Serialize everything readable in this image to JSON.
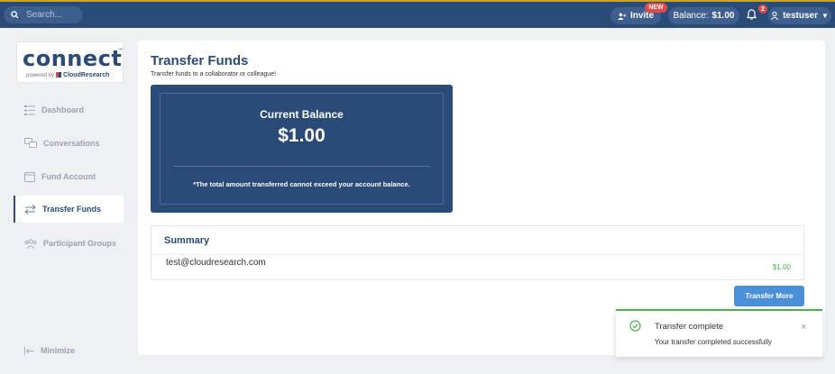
{
  "topbar": {
    "search_placeholder": "Search...",
    "invite_label": "Invite",
    "new_badge": "NEW",
    "balance_label": "Balance:",
    "balance_value": "$1.00",
    "notification_count": "2",
    "username": "testuser",
    "accent_color": "#2a4a78",
    "highlight_color": "#c9a52a"
  },
  "logo": {
    "name": "connect",
    "powered_by": "powered by",
    "brand": "CloudResearch",
    "trademark": "™"
  },
  "sidebar": {
    "items": [
      {
        "label": "Dashboard",
        "icon": "dashboard-icon"
      },
      {
        "label": "Conversations",
        "icon": "chat-icon"
      },
      {
        "label": "Fund Account",
        "icon": "wallet-icon"
      },
      {
        "label": "Transfer Funds",
        "icon": "transfer-icon",
        "active": true
      },
      {
        "label": "Participant Groups",
        "icon": "group-icon"
      }
    ],
    "minimize_label": "Minimize"
  },
  "main": {
    "title": "Transfer Funds",
    "subtitle": "Transfer funds to a collaborator or colleague!",
    "balance_card": {
      "label": "Current Balance",
      "value": "$1.00",
      "note": "*The total amount transferred cannot exceed your account balance."
    },
    "summary": {
      "title": "Summary",
      "email": "test@cloudresearch.com",
      "amount": "$1.00"
    },
    "transfer_more_label": "Transfer More"
  },
  "toast": {
    "title": "Transfer complete",
    "message": "Your transfer completed successfully",
    "close_symbol": "×",
    "status_color": "#4caf50"
  }
}
